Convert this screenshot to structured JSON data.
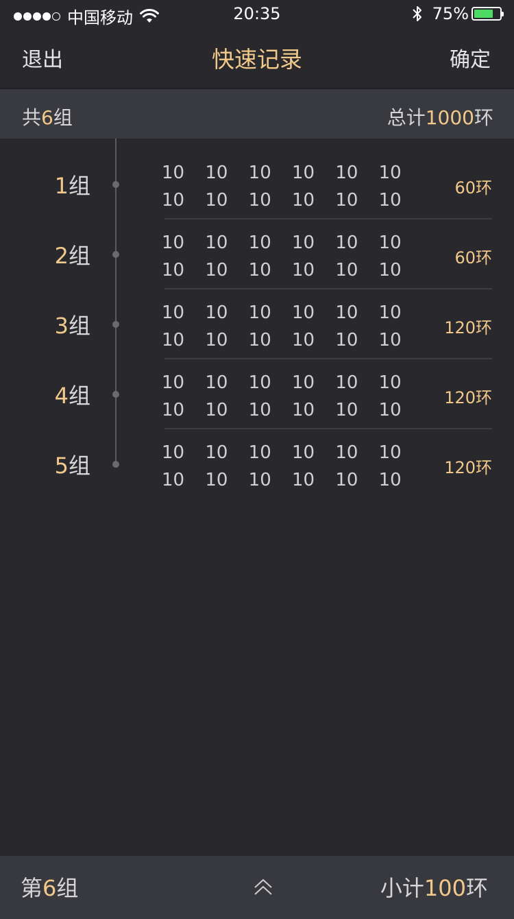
{
  "status_bar": {
    "carrier": "中国移动",
    "time": "20:35",
    "battery_percent": "75%",
    "battery_level": 0.75,
    "signal_bars": 4,
    "signal_total": 5
  },
  "nav": {
    "back_label": "退出",
    "title": "快速记录",
    "confirm_label": "确定"
  },
  "summary": {
    "groups_prefix": "共",
    "groups_count": "6",
    "groups_unit": "组",
    "total_prefix": "总计",
    "total_value": "1000",
    "total_unit": "环"
  },
  "groups": [
    {
      "index": "1",
      "unit": "组",
      "scores": [
        [
          "10",
          "10",
          "10",
          "10",
          "10",
          "10"
        ],
        [
          "10",
          "10",
          "10",
          "10",
          "10",
          "10"
        ]
      ],
      "total": "60环"
    },
    {
      "index": "2",
      "unit": "组",
      "scores": [
        [
          "10",
          "10",
          "10",
          "10",
          "10",
          "10"
        ],
        [
          "10",
          "10",
          "10",
          "10",
          "10",
          "10"
        ]
      ],
      "total": "60环"
    },
    {
      "index": "3",
      "unit": "组",
      "scores": [
        [
          "10",
          "10",
          "10",
          "10",
          "10",
          "10"
        ],
        [
          "10",
          "10",
          "10",
          "10",
          "10",
          "10"
        ]
      ],
      "total": "120环"
    },
    {
      "index": "4",
      "unit": "组",
      "scores": [
        [
          "10",
          "10",
          "10",
          "10",
          "10",
          "10"
        ],
        [
          "10",
          "10",
          "10",
          "10",
          "10",
          "10"
        ]
      ],
      "total": "120环"
    },
    {
      "index": "5",
      "unit": "组",
      "scores": [
        [
          "10",
          "10",
          "10",
          "10",
          "10",
          "10"
        ],
        [
          "10",
          "10",
          "10",
          "10",
          "10",
          "10"
        ]
      ],
      "total": "120环"
    }
  ],
  "bottom": {
    "current_prefix": "第",
    "current_group": "6",
    "current_unit": "组",
    "subtotal_prefix": "小计",
    "subtotal_value": "100",
    "subtotal_unit": "环",
    "expand_icon": "chevron-up-icon"
  },
  "colors": {
    "background": "#29282d",
    "accent": "#f1c98a",
    "band": "#393940",
    "battery": "#4cd964"
  }
}
